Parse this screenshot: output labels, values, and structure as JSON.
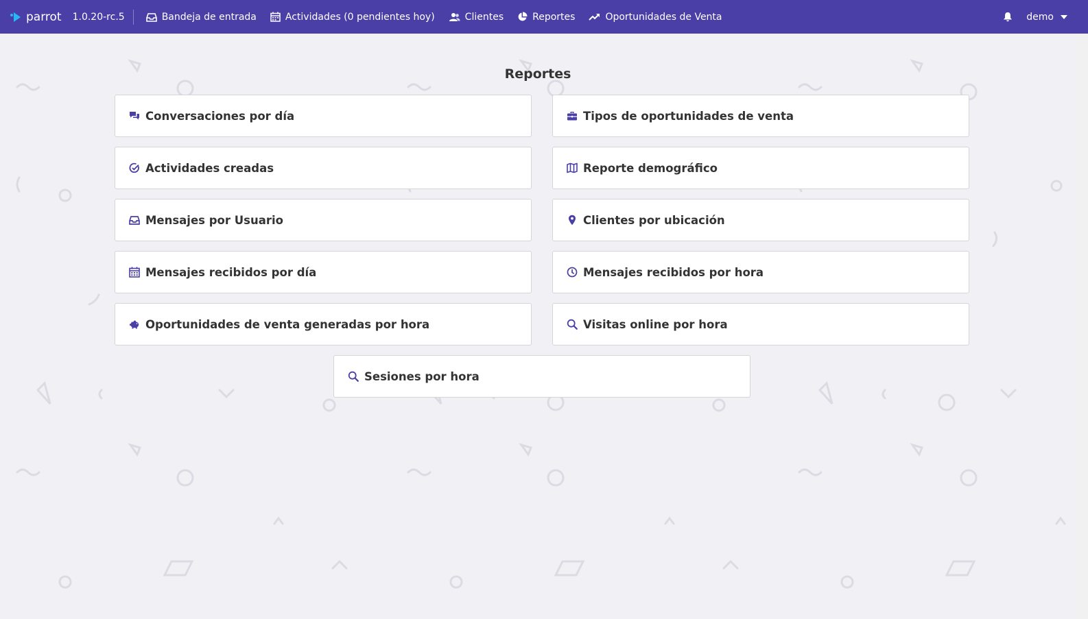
{
  "topbar": {
    "brand": "parrot",
    "version": "1.0.20-rc.5",
    "nav": [
      {
        "label": "Bandeja de entrada",
        "icon": "inbox-icon"
      },
      {
        "label": "Actividades (0 pendientes hoy)",
        "icon": "calendar-icon"
      },
      {
        "label": "Clientes",
        "icon": "users-icon"
      },
      {
        "label": "Reportes",
        "icon": "pie-chart-icon"
      },
      {
        "label": "Oportunidades de Venta",
        "icon": "trending-up-icon"
      }
    ],
    "user": "demo"
  },
  "page": {
    "title": "Reportes"
  },
  "reports": [
    {
      "label": "Conversaciones por día",
      "icon": "comments-icon"
    },
    {
      "label": "Tipos de oportunidades de venta",
      "icon": "briefcase-icon"
    },
    {
      "label": "Actividades creadas",
      "icon": "check-circle-icon"
    },
    {
      "label": "Reporte demográfico",
      "icon": "map-icon"
    },
    {
      "label": "Mensajes por Usuario",
      "icon": "inbox-icon"
    },
    {
      "label": "Clientes por ubicación",
      "icon": "map-marker-icon"
    },
    {
      "label": "Mensajes recibidos por día",
      "icon": "calendar-icon"
    },
    {
      "label": "Mensajes recibidos por hora",
      "icon": "clock-icon"
    },
    {
      "label": "Oportunidades de venta generadas por hora",
      "icon": "piggy-bank-icon"
    },
    {
      "label": "Visitas online por hora",
      "icon": "search-icon"
    },
    {
      "label": "Sesiones por hora",
      "icon": "search-icon"
    }
  ],
  "colors": {
    "topbar": "#4a3fa7",
    "accent_icon": "#4a3fa7",
    "background": "#f1f0f5"
  }
}
